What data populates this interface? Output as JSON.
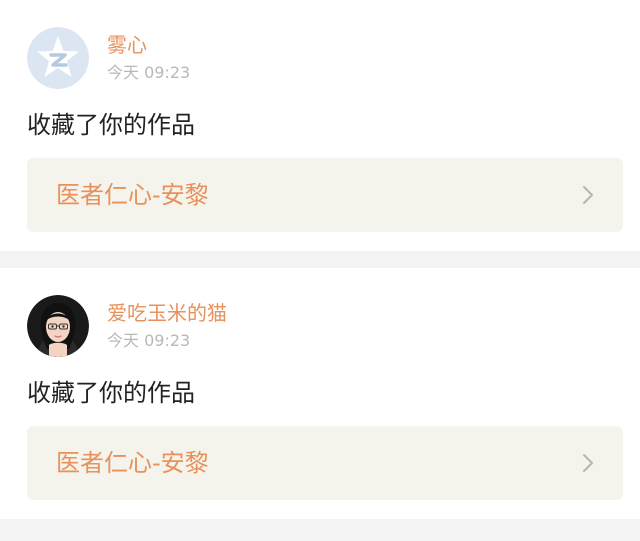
{
  "feed": {
    "items": [
      {
        "user": "雾心",
        "time": "今天 09:23",
        "action": "收藏了你的作品",
        "work_title": "医者仁心-安黎",
        "avatar_icon": "qzone-logo-icon"
      },
      {
        "user": "爱吃玉米的猫",
        "time": "今天 09:23",
        "action": "收藏了你的作品",
        "work_title": "医者仁心-安黎",
        "avatar_icon": "user-portrait-icon"
      }
    ]
  },
  "colors": {
    "accent": "#e8915a",
    "timestamp": "#b8b8b8",
    "card_link_bg": "#f4f4ec",
    "separator": "#f4f4f4"
  }
}
